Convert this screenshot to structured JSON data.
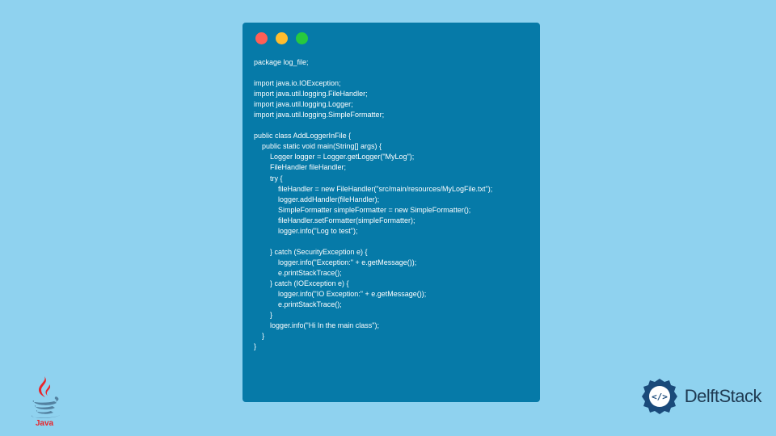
{
  "window": {
    "controls": {
      "red": "close",
      "yellow": "minimize",
      "green": "maximize"
    }
  },
  "code": {
    "lines": [
      "package log_file;",
      "",
      "import java.io.IOException;",
      "import java.util.logging.FileHandler;",
      "import java.util.logging.Logger;",
      "import java.util.logging.SimpleFormatter;",
      "",
      "public class AddLoggerInFile {",
      "    public static void main(String[] args) {",
      "        Logger logger = Logger.getLogger(\"MyLog\");",
      "        FileHandler fileHandler;",
      "        try {",
      "            fileHandler = new FileHandler(\"src/main/resources/MyLogFile.txt\");",
      "            logger.addHandler(fileHandler);",
      "            SimpleFormatter simpleFormatter = new SimpleFormatter();",
      "            fileHandler.setFormatter(simpleFormatter);",
      "            logger.info(\"Log to test\");",
      "",
      "        } catch (SecurityException e) {",
      "            logger.info(\"Exception:\" + e.getMessage());",
      "            e.printStackTrace();",
      "        } catch (IOException e) {",
      "            logger.info(\"IO Exception:\" + e.getMessage());",
      "            e.printStackTrace();",
      "        }",
      "        logger.info(\"Hi In the main class\");",
      "    }",
      "}"
    ]
  },
  "branding": {
    "java_label": "Java",
    "delft_label": "DelftStack"
  }
}
